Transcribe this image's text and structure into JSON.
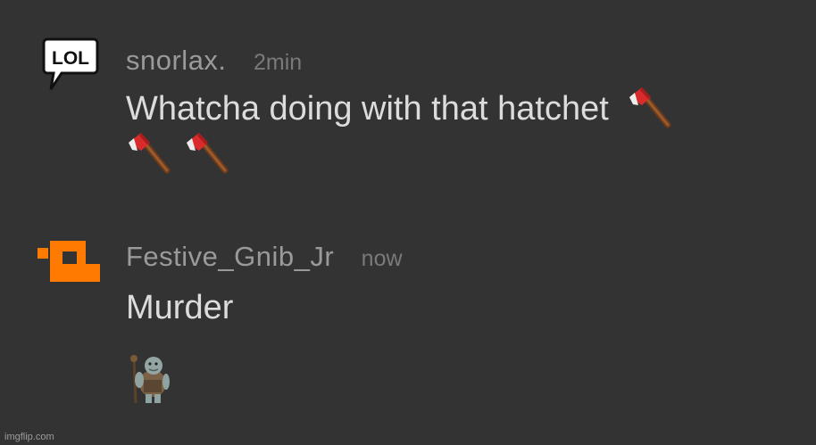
{
  "messages": [
    {
      "avatar": "lol-speech-bubble-icon",
      "username": "snorlax.",
      "timestamp": "2min",
      "text": "Whatcha doing with that hatchet",
      "emoji": [
        "axe-emoji",
        "axe-emoji",
        "axe-emoji"
      ]
    },
    {
      "avatar": "orange-pixel-icon",
      "username": "Festive_Gnib_Jr",
      "timestamp": "now",
      "text": "Murder",
      "attachment": "troll-character-sticker"
    }
  ],
  "avatar_badge": "LOL",
  "watermark": "imgflip.com",
  "colors": {
    "background": "#333333",
    "username": "#9a9a9a",
    "timestamp": "#7a7a7a",
    "message_text": "#dcdcdc",
    "accent_orange": "#ff7a00"
  }
}
